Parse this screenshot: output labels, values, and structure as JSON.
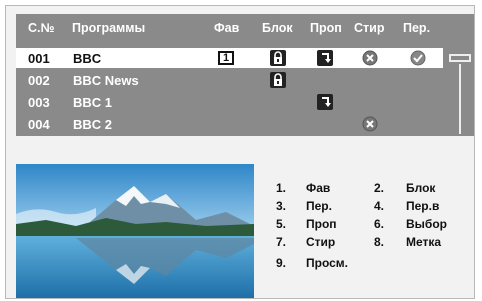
{
  "header": {
    "num": "С.№",
    "programs": "Программы",
    "fav": "Фав",
    "block": "Блок",
    "skip": "Проп",
    "delete": "Стир",
    "move": "Пер."
  },
  "rows": [
    {
      "num": "001",
      "name": "BBC",
      "fav": "1",
      "block": true,
      "skip": true,
      "delete": true,
      "move": true,
      "selected": true
    },
    {
      "num": "002",
      "name": "BBC News",
      "block": true
    },
    {
      "num": "003",
      "name": "BBC 1",
      "skip": true
    },
    {
      "num": "004",
      "name": "BBC 2",
      "delete": true
    }
  ],
  "legend": [
    {
      "key": "1.",
      "label": "Фав"
    },
    {
      "key": "2.",
      "label": "Блок"
    },
    {
      "key": "3.",
      "label": "Пер."
    },
    {
      "key": "4.",
      "label": "Пер.в"
    },
    {
      "key": "5.",
      "label": "Проп"
    },
    {
      "key": "6.",
      "label": "Выбор"
    },
    {
      "key": "7.",
      "label": "Стир"
    },
    {
      "key": "8.",
      "label": "Метка"
    },
    {
      "key": "9.",
      "label": "Просм."
    }
  ],
  "colors": {
    "panel": "#8a8a8a",
    "selected_row": "#ffffff",
    "text_light": "#ffffff",
    "text_dark": "#111111"
  },
  "icons": {
    "block": "lock-icon",
    "skip": "skip-arrow-icon",
    "delete": "delete-x-icon",
    "move": "checkmark-icon"
  }
}
